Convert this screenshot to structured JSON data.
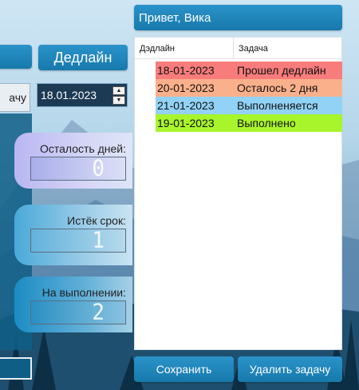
{
  "header": {
    "greeting": "Привет, Вика"
  },
  "controls": {
    "deadline_button": "Дедлайн",
    "add_task_partial": "ачу",
    "date_value": "18.01.2023"
  },
  "stats": [
    {
      "label": "Осталость дней:",
      "value": "0"
    },
    {
      "label": "Истёк срок:",
      "value": "1"
    },
    {
      "label": "На выполнении:",
      "value": "2"
    }
  ],
  "table": {
    "columns": [
      "Дэдлайн",
      "Задача"
    ],
    "rows": [
      {
        "deadline": "18-01-2023",
        "task": "Прошел дедлайн",
        "color": "#f87c7c"
      },
      {
        "deadline": "20-01-2023",
        "task": "Осталось 2 дня",
        "color": "#fbb08c"
      },
      {
        "deadline": "21-01-2023",
        "task": "Выполненяется",
        "color": "#92d2f6"
      },
      {
        "deadline": "19-01-2023",
        "task": "Выполнено",
        "color": "#a8f52c"
      }
    ]
  },
  "footer": {
    "save_button": "Сохранить",
    "delete_button": "Удалить задачу"
  },
  "colors": {
    "button_blue": "#1e85bb",
    "dark_panel": "#0f5e86"
  },
  "icons": {
    "spin_up": "arrow-up-icon",
    "spin_down": "arrow-down-icon"
  }
}
